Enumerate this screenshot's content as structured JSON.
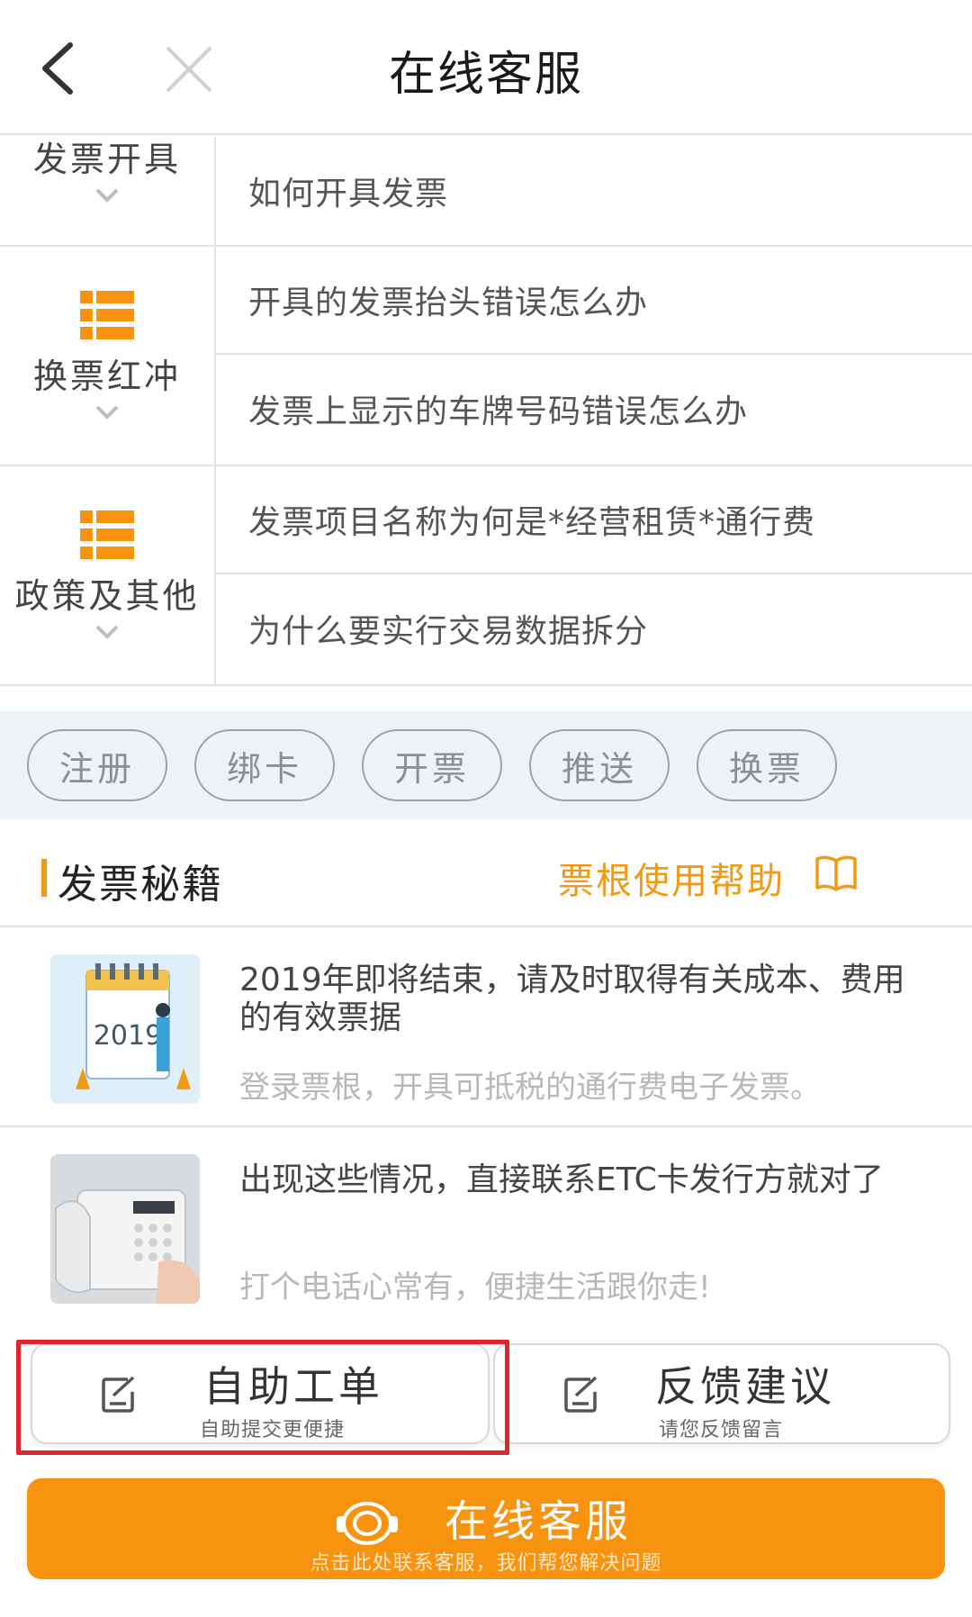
{
  "header": {
    "title": "在线客服"
  },
  "faq": {
    "categories": [
      {
        "label": "发票开具",
        "questions": [
          "如何开具发票"
        ]
      },
      {
        "label": "换票红冲",
        "questions": [
          "开具的发票抬头错误怎么办",
          "发票上显示的车牌号码错误怎么办"
        ]
      },
      {
        "label": "政策及其他",
        "questions": [
          "发票项目名称为何是*经营租赁*通行费",
          "为什么要实行交易数据拆分"
        ]
      }
    ]
  },
  "tags": [
    "注册",
    "绑卡",
    "开票",
    "推送",
    "换票"
  ],
  "section": {
    "title": "发票秘籍",
    "help_link": "票根使用帮助"
  },
  "articles": [
    {
      "title": "2019年即将结束，请及时取得有关成本、费用的有效票据",
      "subtitle": "登录票根，开具可抵税的通行费电子发票。",
      "thumb_text": "2019"
    },
    {
      "title": "出现这些情况，直接联系ETC卡发行方就对了",
      "subtitle": "打个电话心常有，便捷生活跟你走!"
    }
  ],
  "actions": {
    "self_service": {
      "title": "自助工单",
      "subtitle": "自助提交更便捷"
    },
    "feedback": {
      "title": "反馈建议",
      "subtitle": "请您反馈留言"
    }
  },
  "cta": {
    "title": "在线客服",
    "subtitle": "点击此处联系客服，我们帮您解决问题"
  },
  "colors": {
    "accent": "#f7930e",
    "highlight": "#e0242b",
    "tag_bg": "#edf2f6"
  }
}
